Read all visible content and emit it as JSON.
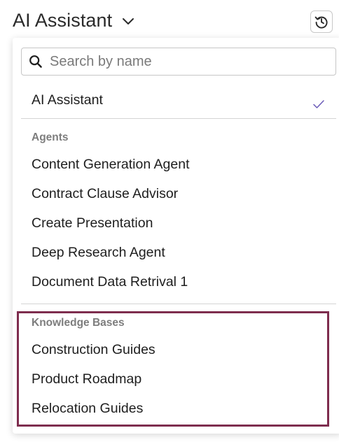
{
  "header": {
    "title": "AI Assistant",
    "chevron_icon": "chevron-down-icon",
    "history_icon": "history-icon"
  },
  "menu": {
    "search": {
      "placeholder": "Search by name",
      "value": "",
      "icon": "search-icon"
    },
    "selected": {
      "label": "AI Assistant",
      "checked": true
    },
    "agents": {
      "heading": "Agents",
      "items": [
        "Content Generation Agent",
        "Contract Clause Advisor",
        "Create Presentation",
        "Deep Research Agent",
        "Document Data Retrival 1"
      ]
    },
    "knowledge_bases": {
      "heading": "Knowledge Bases",
      "items": [
        "Construction Guides",
        "Product Roadmap",
        "Relocation Guides"
      ],
      "highlight_color": "#7e2d4e"
    }
  },
  "colors": {
    "check": "#6b5bb8",
    "section_label": "#7d7d7d"
  }
}
